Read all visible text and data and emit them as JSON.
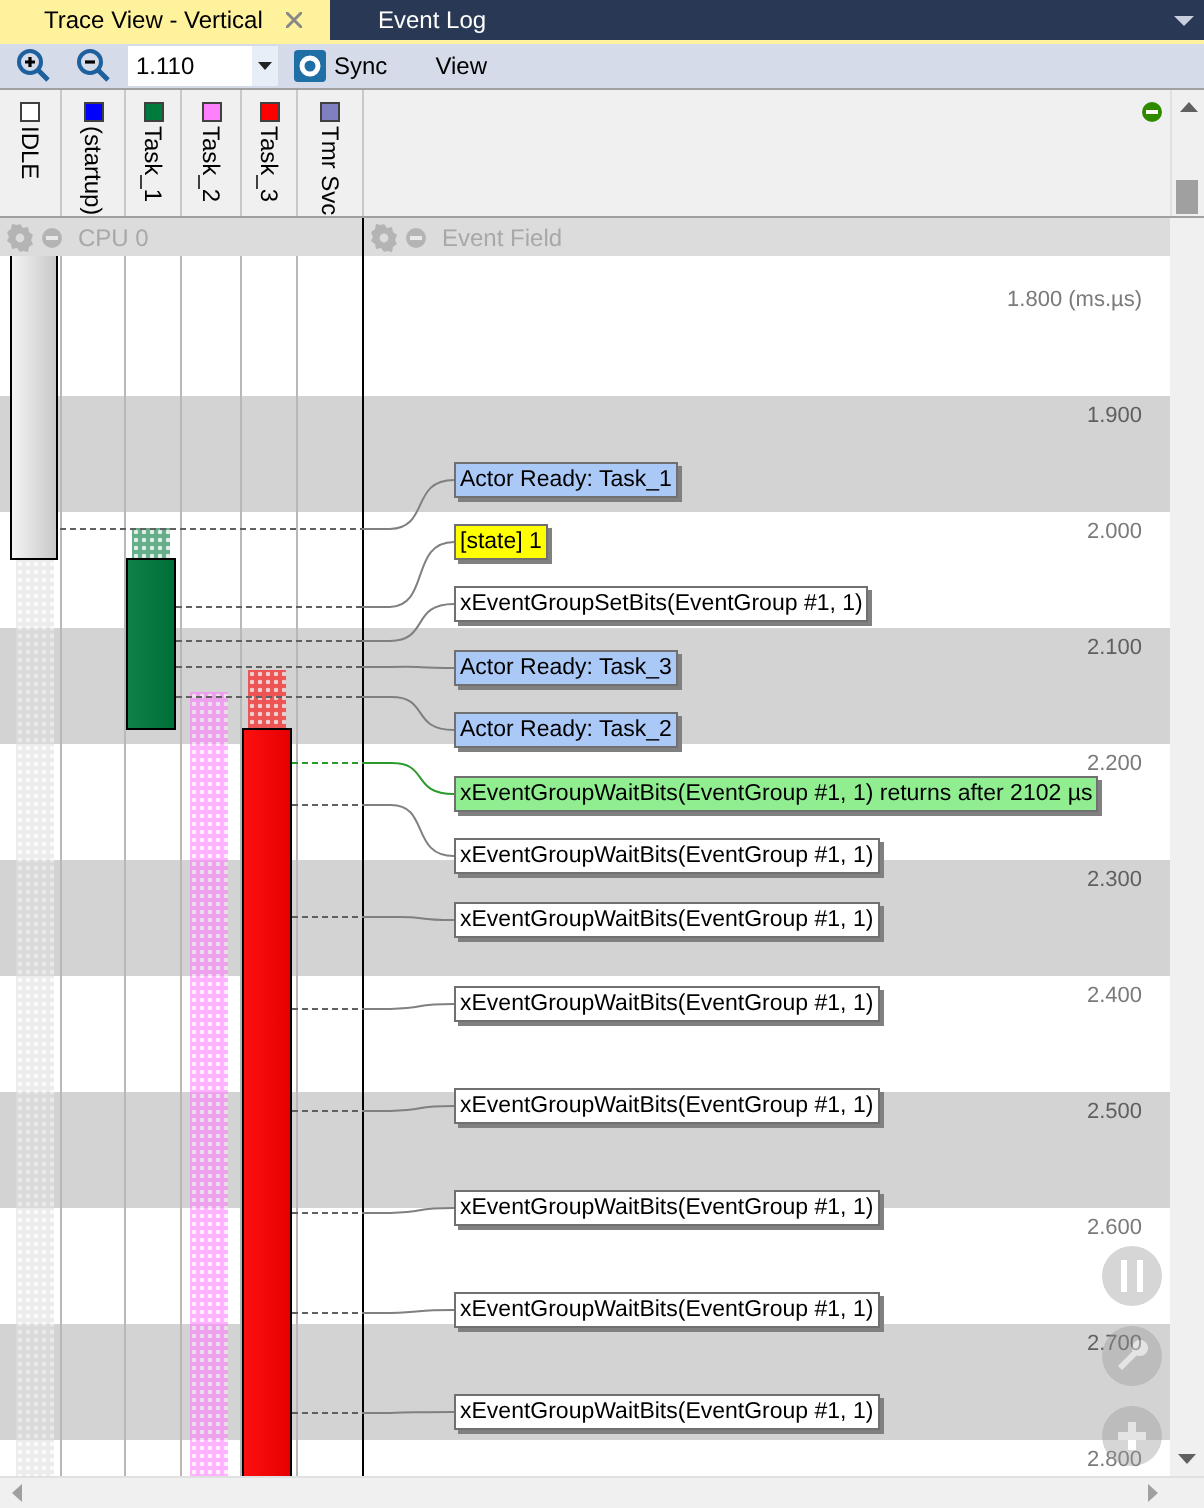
{
  "tabs": [
    {
      "label": "Trace View - Vertical",
      "selected": true,
      "closable": true
    },
    {
      "label": "Event Log",
      "selected": false,
      "closable": false
    }
  ],
  "toolbar": {
    "zoom_value": "1.110",
    "sync_label": "Sync",
    "view_label": "View"
  },
  "columns": [
    {
      "label": "IDLE",
      "color": "#ffffff"
    },
    {
      "label": "(startup)",
      "color": "#0000ff"
    },
    {
      "label": "Task_1",
      "color": "#007a3d"
    },
    {
      "label": "Task_2",
      "color": "#ff80ff"
    },
    {
      "label": "Task_3",
      "color": "#ff0000"
    },
    {
      "label": "Tmr Svc",
      "color": "#8080c0"
    }
  ],
  "panels": [
    {
      "label": "CPU 0"
    },
    {
      "label": "Event Field"
    }
  ],
  "time_labels": [
    "1.800 (ms.µs)",
    "1.900",
    "2.000",
    "2.100",
    "2.200",
    "2.300",
    "2.400",
    "2.500",
    "2.600",
    "2.700",
    "2.800"
  ],
  "events": [
    {
      "kind": "ready",
      "text": "Actor Ready: Task_1"
    },
    {
      "kind": "state",
      "text": "[state] 1"
    },
    {
      "kind": "call",
      "text": "xEventGroupSetBits(EventGroup #1, 1)"
    },
    {
      "kind": "ready",
      "text": "Actor Ready: Task_3"
    },
    {
      "kind": "ready",
      "text": "Actor Ready: Task_2"
    },
    {
      "kind": "return",
      "text": "xEventGroupWaitBits(EventGroup #1, 1) returns after 2102 µs"
    },
    {
      "kind": "call",
      "text": "xEventGroupWaitBits(EventGroup #1, 1)"
    },
    {
      "kind": "call",
      "text": "xEventGroupWaitBits(EventGroup #1, 1)"
    },
    {
      "kind": "call",
      "text": "xEventGroupWaitBits(EventGroup #1, 1)"
    },
    {
      "kind": "call",
      "text": "xEventGroupWaitBits(EventGroup #1, 1)"
    },
    {
      "kind": "call",
      "text": "xEventGroupWaitBits(EventGroup #1, 1)"
    },
    {
      "kind": "call",
      "text": "xEventGroupWaitBits(EventGroup #1, 1)"
    },
    {
      "kind": "call",
      "text": "xEventGroupWaitBits(EventGroup #1, 1)"
    }
  ]
}
